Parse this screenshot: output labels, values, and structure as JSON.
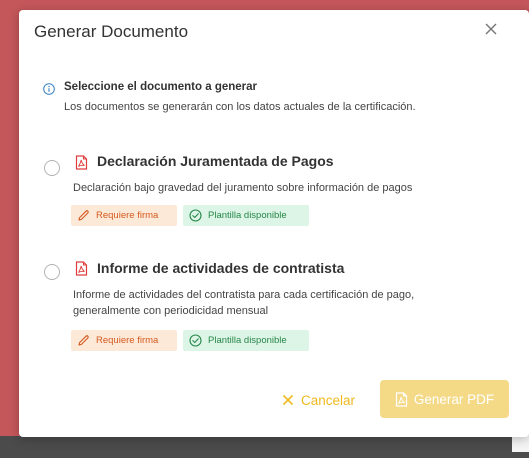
{
  "dialog": {
    "title": "Generar Documento",
    "info": {
      "title": "Seleccione el documento a generar",
      "description": "Los documentos se generarán con los datos actuales de la certificación."
    },
    "documents": [
      {
        "title": "Declaración Juramentada de Pagos",
        "description": "Declaración bajo gravedad del juramento sobre información de pagos",
        "badges": [
          "Requiere firma",
          "Plantilla disponible"
        ],
        "selected": false
      },
      {
        "title": "Informe de actividades de contratista",
        "description_line1": "Informe de actividades del contratista para cada certificación de pago,",
        "description_line2": "generalmente con periodicidad mensual",
        "badges": [
          "Requiere firma",
          "Plantilla disponible"
        ],
        "selected": false
      }
    ],
    "actions": {
      "cancel_label": "Cancelar",
      "generate_label": "Generar PDF"
    }
  },
  "colors": {
    "accent": "#f0b91f",
    "pdf_icon": "#e03c3c",
    "warn_badge_text": "#d45a1f",
    "ok_badge_text": "#27864a",
    "info_icon": "#3b82c4"
  },
  "icons": {
    "close": "close-icon",
    "info": "info-icon",
    "pdf": "pdf-file-icon",
    "signature": "pen-icon",
    "template": "check-circle-icon"
  }
}
